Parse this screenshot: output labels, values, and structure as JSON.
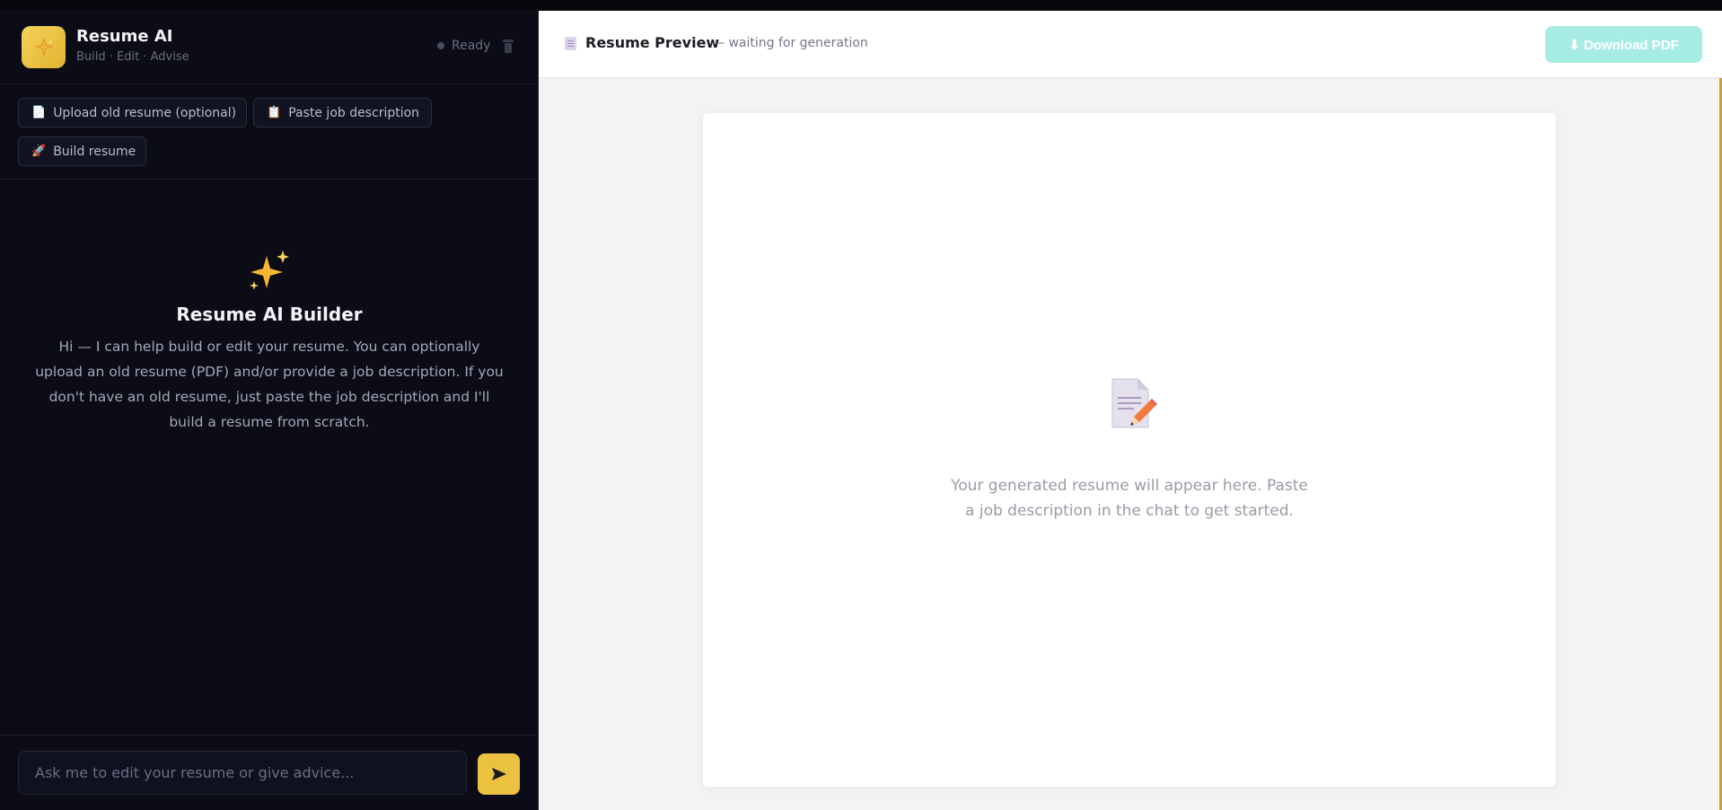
{
  "sidebar": {
    "app_title": "Resume AI",
    "app_subtitle": "Build · Edit · Advise",
    "status": "Ready",
    "actions": [
      {
        "icon": "📄",
        "label": "Upload old resume (optional)"
      },
      {
        "icon": "📋",
        "label": "Paste job description"
      },
      {
        "icon": "🚀",
        "label": "Build resume"
      }
    ],
    "welcome": {
      "icon": "✨",
      "title": "Resume AI Builder",
      "text": "Hi — I can help build or edit your resume. You can optionally upload an old resume (PDF) and/or provide a job description. If you don't have an old resume, just paste the job description and I'll build a resume from scratch."
    },
    "composer": {
      "placeholder": "Ask me to edit your resume or give advice...",
      "send_icon": "➤"
    }
  },
  "preview": {
    "title": "Resume Preview",
    "subtitle": "— waiting for generation",
    "download_label": "⬇ Download PDF",
    "empty_text": "Your generated resume will appear here. Paste a job description in the chat to get started."
  },
  "colors": {
    "accent": "#ebc23f",
    "download_disabled": "#a7ece3",
    "sidebar_bg": "#0b0c16",
    "preview_bg": "#f3f3f4"
  }
}
